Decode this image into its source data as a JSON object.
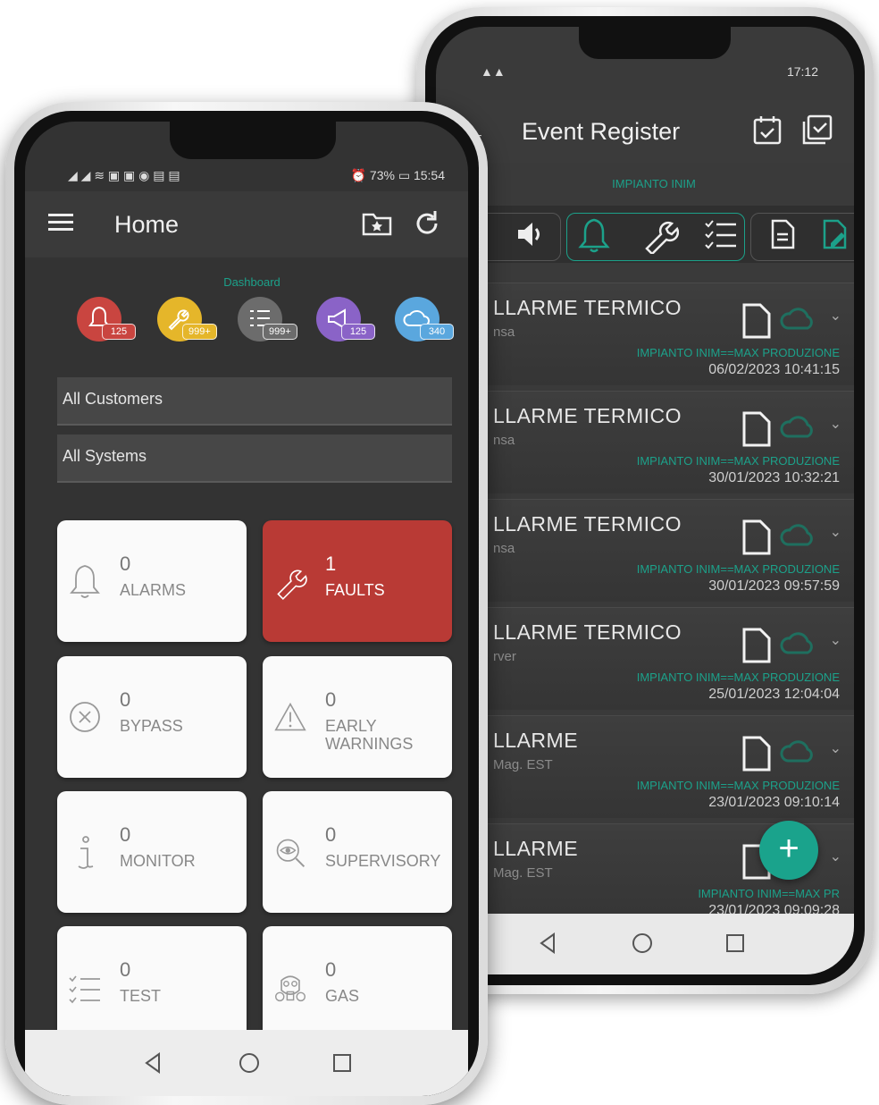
{
  "back_phone": {
    "status": {
      "signal": "▲▲",
      "time": "17:12"
    },
    "header": {
      "title": "Event Register",
      "back_icon": "arrow-left-icon"
    },
    "subtitle": "IMPIANTO INIM",
    "events": [
      {
        "title": "LLARME TERMICO",
        "sub": "nsa",
        "plant": "IMPIANTO INIM==MAX PRODUZIONE",
        "date": "06/02/2023 10:41:15"
      },
      {
        "title": "LLARME TERMICO",
        "sub": "nsa",
        "plant": "IMPIANTO INIM==MAX PRODUZIONE",
        "date": "30/01/2023 10:32:21"
      },
      {
        "title": "LLARME TERMICO",
        "sub": "nsa",
        "plant": "IMPIANTO INIM==MAX PRODUZIONE",
        "date": "30/01/2023 09:57:59"
      },
      {
        "title": "LLARME TERMICO",
        "sub": "rver",
        "plant": "IMPIANTO INIM==MAX PRODUZIONE",
        "date": "25/01/2023 12:04:04"
      },
      {
        "title": "LLARME",
        "sub": "Mag. EST",
        "plant": "IMPIANTO INIM==MAX PRODUZIONE",
        "date": "23/01/2023 09:10:14"
      },
      {
        "title": "LLARME",
        "sub": "Mag. EST",
        "plant": "IMPIANTO INIM==MAX PR",
        "date": "23/01/2023 09:09:28"
      }
    ],
    "fab_label": "+"
  },
  "front_phone": {
    "status": {
      "signal": "◢ ◢ ≋ ▣ ▣ ◉ ▤ ▤",
      "right": "⏰ 73% ▭ 15:54"
    },
    "header": {
      "title": "Home"
    },
    "dashboard_label": "Dashboard",
    "dashboard": [
      {
        "name": "alarms",
        "badge": "125",
        "color": "#c94540",
        "badge_color": "#c94540"
      },
      {
        "name": "faults",
        "badge": "999+",
        "color": "#e5b62a",
        "badge_color": "#e5b62a"
      },
      {
        "name": "test",
        "badge": "999+",
        "color": "#6c6c6c",
        "badge_color": "#6c6c6c"
      },
      {
        "name": "supervisory",
        "badge": "125",
        "color": "#8a63c7",
        "badge_color": "#8a63c7"
      },
      {
        "name": "cloud",
        "badge": "340",
        "color": "#5aa7de",
        "badge_color": "#5aa7de"
      }
    ],
    "filters": {
      "customers": "All Customers",
      "systems": "All Systems"
    },
    "tiles": [
      {
        "count": "0",
        "label": "ALARMS",
        "icon": "bell-icon"
      },
      {
        "count": "1",
        "label": "FAULTS",
        "icon": "wrench-icon"
      },
      {
        "count": "0",
        "label": "BYPASS",
        "icon": "circle-x-icon"
      },
      {
        "count": "0",
        "label": "EARLY WARNINGS",
        "icon": "warning-icon"
      },
      {
        "count": "0",
        "label": "MONITOR",
        "icon": "info-icon"
      },
      {
        "count": "0",
        "label": "SUPERVISORY",
        "icon": "eye-search-icon"
      },
      {
        "count": "0",
        "label": "TEST",
        "icon": "checklist-icon"
      },
      {
        "count": "0",
        "label": "GAS",
        "icon": "gas-mask-icon"
      }
    ]
  }
}
